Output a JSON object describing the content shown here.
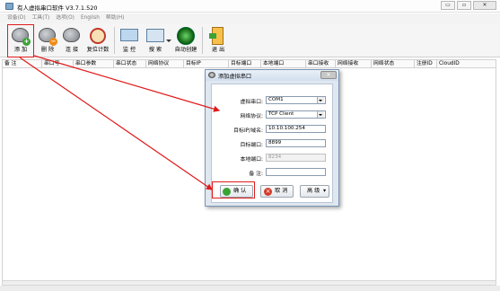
{
  "window": {
    "title": "有人虚拟串口软件 V3.7.1.520",
    "controls": {
      "minimize": "▭",
      "maximize": "▫",
      "close": "✕"
    }
  },
  "menu": [
    {
      "label": "设备(D)"
    },
    {
      "label": "工具(T)"
    },
    {
      "label": "选项(O)"
    },
    {
      "label": "English"
    },
    {
      "label": "帮助(H)"
    }
  ],
  "toolbar": {
    "add": "添 加",
    "delete": "删 除",
    "connect": "连 接",
    "reset_count": "复位计数",
    "monitor": "监 控",
    "search": "搜 索",
    "auto_create": "自动创建",
    "exit": "退 出",
    "badge_plus": "+",
    "badge_minus": "−"
  },
  "grid": {
    "columns": [
      "备 注",
      "串口号",
      "串口参数",
      "串口状态",
      "网络协议",
      "目标IP",
      "目标端口",
      "本地端口",
      "串口接收",
      "网络接收",
      "网络状态",
      "注册ID",
      "CloudID"
    ]
  },
  "dialog": {
    "title": "添加虚拟串口",
    "fields": {
      "virtual_port": {
        "label": "虚拟串口:",
        "value": "COM1"
      },
      "protocol": {
        "label": "网络协议:",
        "value": "TCP Client"
      },
      "target_ip": {
        "label": "目标IP/域名:",
        "value": "10.10.100.254"
      },
      "target_port": {
        "label": "目标端口:",
        "value": "8899"
      },
      "local_port": {
        "label": "本地端口:",
        "value": "8234"
      },
      "remark": {
        "label": "备 注:",
        "value": ""
      }
    },
    "buttons": {
      "ok": "确 认",
      "cancel": "取 消",
      "advanced": "高 级",
      "advanced_arrow": "▾"
    }
  },
  "colors": {
    "annotation": "#e01b1b"
  }
}
